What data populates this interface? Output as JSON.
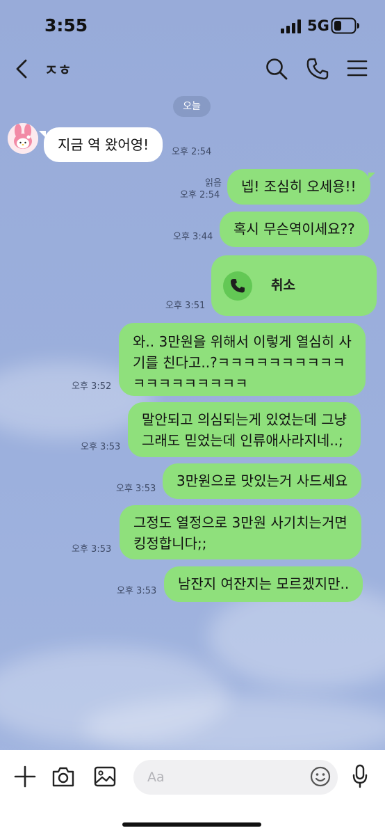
{
  "status_bar": {
    "time": "3:55",
    "network": "5G"
  },
  "header": {
    "title": "ㅈㅎ"
  },
  "date_divider": "오늘",
  "composer": {
    "placeholder": "Aa"
  },
  "colors": {
    "background": "#9cb0dd",
    "sent_bubble": "#8fe07c",
    "received_bubble": "#ffffff"
  },
  "icons": [
    "back-icon",
    "search-icon",
    "call-icon",
    "menu-icon",
    "phone-icon",
    "plus-icon",
    "camera-icon",
    "image-icon",
    "emoji-icon",
    "mic-icon"
  ],
  "messages": [
    {
      "side": "received",
      "text": "지금 역 왔어영!",
      "time": "오후 2:54"
    },
    {
      "side": "sent",
      "text": "넵! 조심히 오세용!!",
      "read": "읽음",
      "time": "오후 2:54"
    },
    {
      "side": "sent",
      "text": "혹시 무슨역이세요??",
      "time": "오후 3:44"
    },
    {
      "side": "sent",
      "type": "call",
      "text": "취소",
      "time": "오후 3:51"
    },
    {
      "side": "sent",
      "text": "와.. 3만원을 위해서 이렇게 열심히 사\n기를 친다고..?ㅋㅋㅋㅋㅋㅋㅋㅋㅋㅋ\nㅋㅋㅋㅋㅋㅋㅋㅋㅋ",
      "time": "오후 3:52"
    },
    {
      "side": "sent",
      "text": "말안되고 의심되는게 있었는데 그냥\n그래도 믿었는데 인류애사라지네..;",
      "time": "오후 3:53"
    },
    {
      "side": "sent",
      "text": "3만원으로 맛있는거 사드세요",
      "time": "오후 3:53"
    },
    {
      "side": "sent",
      "text": "그정도 열정으로 3만원 사기치는거면\n킹정합니다;;",
      "time": "오후 3:53"
    },
    {
      "side": "sent",
      "text": "남잔지 여잔지는 모르겠지만..",
      "time": "오후 3:53"
    }
  ]
}
